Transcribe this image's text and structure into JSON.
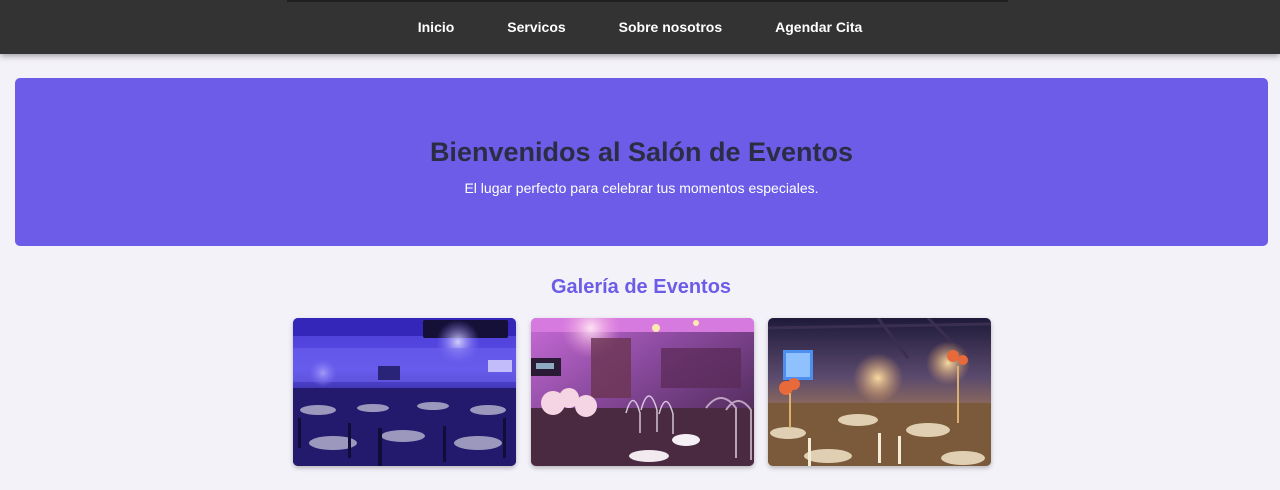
{
  "nav": {
    "items": [
      {
        "label": "Inicio"
      },
      {
        "label": "Servicos"
      },
      {
        "label": "Sobre nosotros"
      },
      {
        "label": "Agendar Cita"
      }
    ]
  },
  "hero": {
    "title": "Bienvenidos al Salón de Eventos",
    "subtitle": "El lugar perfecto para celebrar tus momentos especiales."
  },
  "gallery": {
    "title": "Galería de Eventos",
    "images": [
      {
        "name": "event-photo-1"
      },
      {
        "name": "event-photo-2"
      },
      {
        "name": "event-photo-3"
      }
    ]
  },
  "colors": {
    "navbar": "#333333",
    "accent": "#6c5ce7",
    "hero_title": "#2d2c45",
    "page_bg": "#f3f2f8"
  }
}
